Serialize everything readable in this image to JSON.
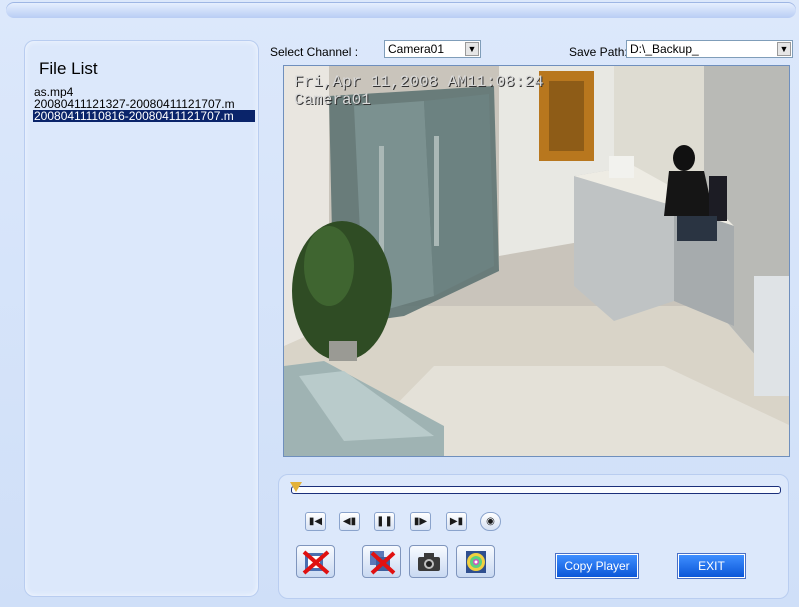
{
  "file_list": {
    "title": "File List",
    "items": [
      "as.mp4",
      "20080411121327-20080411121707.m",
      "20080411110816-20080411121707.m"
    ],
    "selected_index": 2
  },
  "channel": {
    "label": "Select Channel :",
    "value": "Camera01"
  },
  "save_path": {
    "label": "Save Path:",
    "value": "D:\\_Backup_"
  },
  "video": {
    "timestamp": "Fri,Apr 11,2008 AM11:08:24",
    "camera_name": "Camera01"
  },
  "playback": {
    "position_fraction": 0.0,
    "buttons": [
      "skip-to-start-icon",
      "step-back-icon",
      "pause-icon",
      "step-forward-icon",
      "skip-to-end-icon",
      "volume-icon"
    ]
  },
  "actions": {
    "copy_player": "Copy Player",
    "exit": "EXIT"
  },
  "colors": {
    "selection": "#0a246a",
    "action_button": "#1f6cf0",
    "panel": "#dce8fb"
  }
}
